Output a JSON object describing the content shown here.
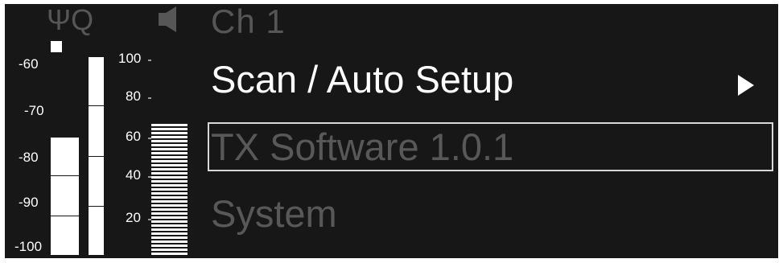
{
  "status": {
    "antenna_label": "ΨQ",
    "channel": "Ch 1"
  },
  "af_scale": [
    "-60",
    "-70",
    "-80",
    "-90",
    "-100"
  ],
  "rf_scale": [
    "100",
    "80",
    "60",
    "40",
    "20"
  ],
  "meters": {
    "af_level_db": -76,
    "rf_level_pct": 62
  },
  "menu": {
    "items": [
      {
        "label": "Scan / Auto Setup",
        "state": "active",
        "has_submenu": true
      },
      {
        "label": "TX Software  1.0.1",
        "state": "selected"
      },
      {
        "label": "System",
        "state": "inactive"
      }
    ]
  },
  "colors": {
    "background": "#171717",
    "foreground": "#ffffff",
    "dimmed": "#565656",
    "selection_border": "#d8d8d8"
  },
  "icons": [
    "antenna-icon",
    "speaker-mute-icon",
    "chevron-right-icon"
  ]
}
